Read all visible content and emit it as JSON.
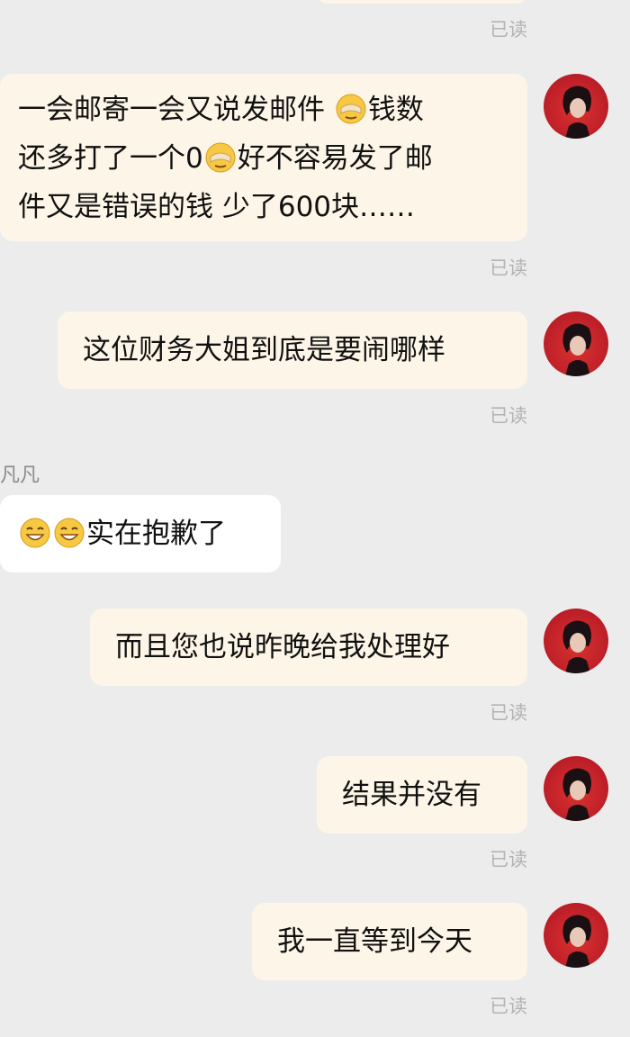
{
  "messages": [
    {
      "text_lines": [
        "一会邮寄一会又说发邮件 ",
        "钱数",
        "还多打了一个0",
        "好不容易发了邮",
        "件又是错误的钱 少了600块……"
      ]
    },
    {
      "text": "这位财务大姐到底是要闹哪样"
    },
    {
      "sender": "凡凡",
      "text": "实在抱歉了"
    },
    {
      "text": "而且您也说昨晚给我处理好"
    },
    {
      "text": "结果并没有"
    },
    {
      "text": "我一直等到今天"
    }
  ],
  "read_label": "已读",
  "icons": {
    "avatar": "user-avatar-icon",
    "facepalm": "facepalm-emoji-icon",
    "sweat_smile": "sweat-smile-emoji-icon"
  },
  "colors": {
    "background": "#ececec",
    "outgoing_bubble": "#fdf6e8",
    "incoming_bubble": "#ffffff",
    "read_text": "#b3b3b3",
    "avatar_bg": "#c3222a"
  }
}
